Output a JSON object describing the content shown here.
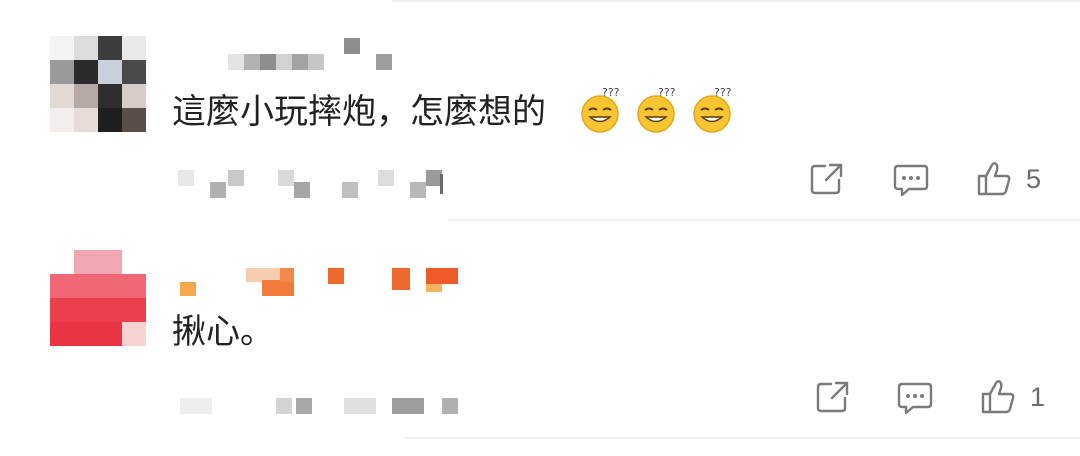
{
  "colors": {
    "text": "#222222",
    "icon": "#7a7a7a",
    "divider": "#f1f1f1"
  },
  "comments": [
    {
      "text": "這麼小玩摔炮，怎麼想的",
      "emoji_count": 3,
      "emoji_name": "thinking-smile-emoji",
      "likes": "5",
      "actions": [
        "share-icon",
        "reply-icon",
        "like-icon"
      ]
    },
    {
      "text": "揪心。",
      "likes": "1",
      "actions": [
        "share-icon",
        "reply-icon",
        "like-icon"
      ]
    }
  ]
}
